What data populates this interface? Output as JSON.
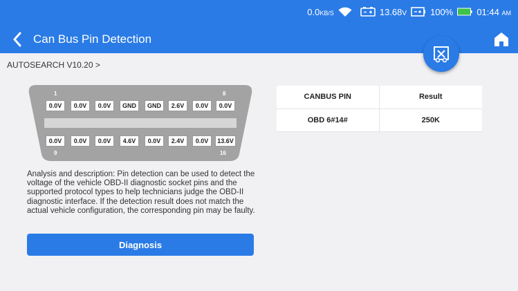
{
  "status_bar": {
    "net_speed_value": "0.0",
    "net_speed_unit": "KB/S",
    "wifi_icon": "wifi-icon",
    "voltage_icon": "car-battery-icon",
    "voltage": "13.68",
    "voltage_unit": "V",
    "battery_icon": "battery-icon",
    "battery": "100%",
    "time": "01:44",
    "ampm": "AM"
  },
  "header": {
    "back_icon": "back-arrow-icon",
    "title": "Can Bus Pin Detection",
    "home_icon": "home-icon"
  },
  "fab": {
    "icon": "exit-report-icon"
  },
  "breadcrumb": "AUTOSEARCH V10.20 >",
  "connector": {
    "pin_num_top_left": "1",
    "pin_num_top_right": "8",
    "pin_num_bottom_left": "9",
    "pin_num_bottom_right": "16",
    "top_row": [
      "0.0V",
      "0.0V",
      "0.0V",
      "GND",
      "GND",
      "2.6V",
      "0.0V",
      "0.0V"
    ],
    "bottom_row": [
      "0.0V",
      "0.0V",
      "0.0V",
      "4.6V",
      "0.0V",
      "2.4V",
      "0.0V",
      "13.6V"
    ]
  },
  "description": "Analysis and description: Pin detection can be used to detect the voltage of the vehicle OBD-II diagnostic socket pins and the supported protocol types to help technicians judge the OBD-II diagnostic interface. If the detection result does not match the actual vehicle configuration, the corresponding pin may be faulty.",
  "diagnosis_button": "Diagnosis",
  "table": {
    "headers": [
      "CANBUS PIN",
      "Result"
    ],
    "rows": [
      [
        "OBD 6#14#",
        "250K"
      ]
    ]
  },
  "colors": {
    "primary": "#2a7be6",
    "background": "#f1f1f3",
    "connector": "#a3a3a3"
  }
}
